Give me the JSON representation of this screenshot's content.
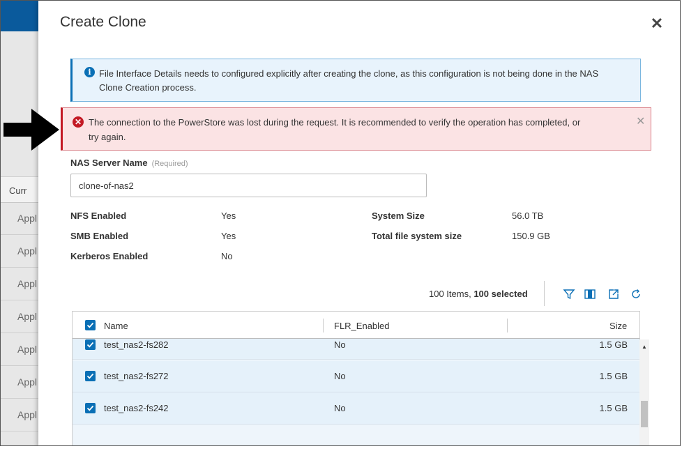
{
  "background_app": {
    "column_header": "Curr",
    "rows": [
      "Appl",
      "Appl",
      "Appl",
      "Appl",
      "Appl",
      "Appl",
      "Appl"
    ]
  },
  "modal": {
    "title": "Create Clone",
    "info_alert": "File Interface Details needs to configured explicitly after creating the clone, as this configuration is not being done in the NAS Clone Creation process.",
    "error_alert": "The connection to the PowerStore was lost during the request. It is recommended to verify the operation has completed, or try again.",
    "nas_name_label": "NAS Server Name",
    "nas_name_required": "(Required)",
    "nas_name_value": "clone-of-nas2",
    "properties": {
      "nfs_label": "NFS Enabled",
      "nfs_value": "Yes",
      "smb_label": "SMB Enabled",
      "smb_value": "Yes",
      "kerberos_label": "Kerberos Enabled",
      "kerberos_value": "No",
      "system_size_label": "System Size",
      "system_size_value": "56.0 TB",
      "total_fs_label": "Total file system size",
      "total_fs_value": "150.9 GB"
    },
    "toolbar": {
      "items_count": "100 Items,",
      "selected_count": "100 selected"
    },
    "table": {
      "columns": [
        "Name",
        "FLR_Enabled",
        "Size"
      ],
      "rows": [
        {
          "name": "test_nas2-fs282",
          "flr": "No",
          "size": "1.5 GB"
        },
        {
          "name": "test_nas2-fs272",
          "flr": "No",
          "size": "1.5 GB"
        },
        {
          "name": "test_nas2-fs242",
          "flr": "No",
          "size": "1.5 GB"
        }
      ]
    }
  },
  "colors": {
    "accent": "#0a6fb5",
    "error": "#c31924",
    "info_bg": "#e8f3fc",
    "error_bg": "#fbe3e4",
    "row_selected_bg": "#e5f1fa"
  },
  "icons": [
    "info-icon",
    "error-icon",
    "close-icon",
    "filter-icon",
    "columns-icon",
    "export-icon",
    "refresh-icon",
    "checkbox-checked-icon",
    "arrow-annotation"
  ]
}
